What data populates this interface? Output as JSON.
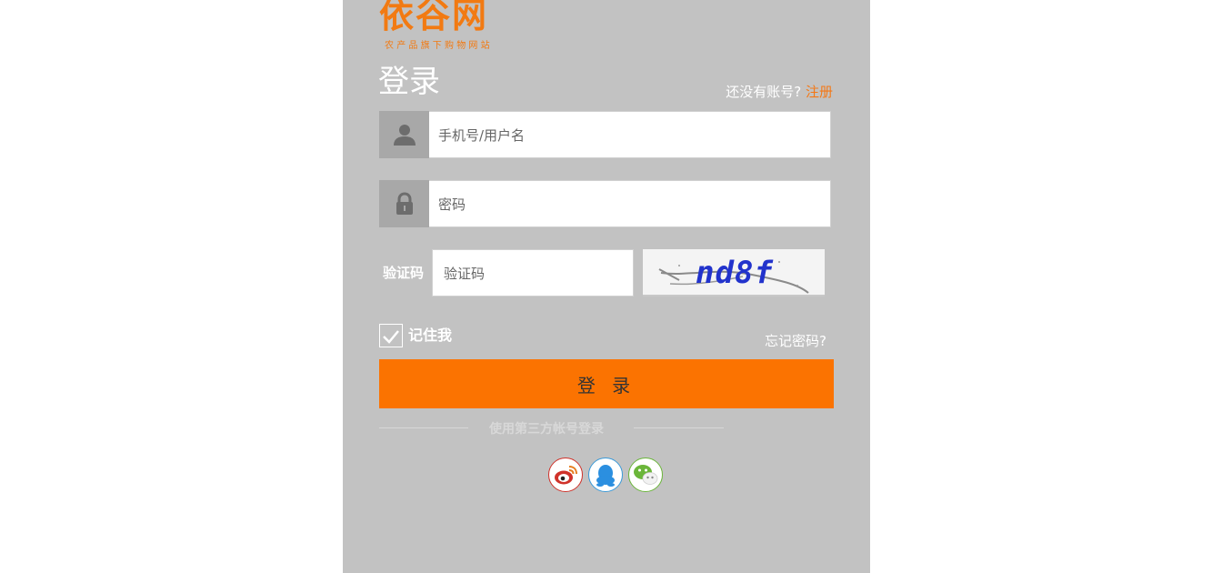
{
  "logo": {
    "name": "依谷网",
    "tagline": "农产品旗下购物网站"
  },
  "page": {
    "title": "登录"
  },
  "signup": {
    "prompt": "还没有账号?",
    "link": "注册"
  },
  "form": {
    "username_placeholder": "手机号/用户名",
    "password_placeholder": "密码",
    "captcha_label": "验证码",
    "captcha_placeholder": "验证码",
    "captcha_text": "nd8f",
    "remember_label": "记住我",
    "remember_checked": true,
    "forgot_link": "忘记密码?",
    "login_button": "登 录"
  },
  "third_party": {
    "label": "使用第三方帐号登录",
    "icons": [
      "weibo-icon",
      "qq-icon",
      "wechat-icon"
    ]
  },
  "colors": {
    "accent": "#fb7301",
    "panel_bg": "#c2c2c2",
    "link": "#f47816"
  }
}
